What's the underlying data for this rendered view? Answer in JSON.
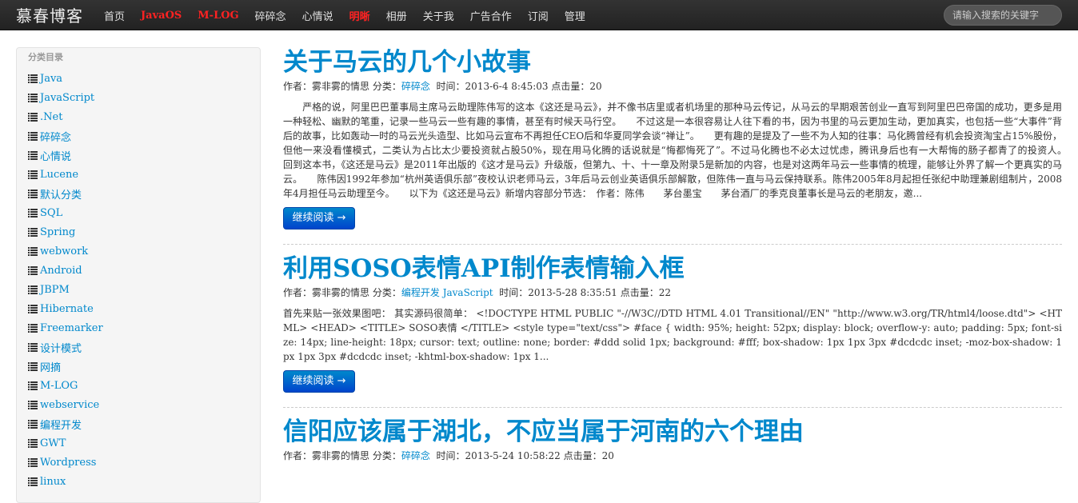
{
  "header": {
    "brand": "慕春博客",
    "nav": [
      {
        "label": "首页",
        "highlight": false
      },
      {
        "label": "JavaOS",
        "highlight": true
      },
      {
        "label": "M-LOG",
        "highlight": true
      },
      {
        "label": "碎碎念",
        "highlight": false
      },
      {
        "label": "心情说",
        "highlight": false
      },
      {
        "label": "明晰",
        "highlight": true
      },
      {
        "label": "相册",
        "highlight": false
      },
      {
        "label": "关于我",
        "highlight": false
      },
      {
        "label": "广告合作",
        "highlight": false
      },
      {
        "label": "订阅",
        "highlight": false
      },
      {
        "label": "管理",
        "highlight": false
      }
    ],
    "search_placeholder": "请输入搜索的关键字"
  },
  "sidebar": {
    "title": "分类目录",
    "categories": [
      "Java",
      "JavaScript",
      ".Net",
      "碎碎念",
      "心情说",
      "Lucene",
      "默认分类",
      "SQL",
      "Spring",
      "webwork",
      "Android",
      "JBPM",
      "Hibernate",
      "Freemarker",
      "设计模式",
      "网摘",
      "M-LOG",
      "webservice",
      "编程开发",
      "GWT",
      "Wordpress",
      "linux"
    ]
  },
  "labels": {
    "author_prefix": "作者：",
    "category_prefix": "分类：",
    "time_prefix": "时间：",
    "clicks_prefix": "点击量：",
    "read_more": "继续阅读 →"
  },
  "posts": [
    {
      "title": "关于马云的几个小故事",
      "author": "雾非雾的情思",
      "categories": "碎碎念",
      "time": "2013-6-4 8:45:03",
      "clicks": "20",
      "excerpt": "　　严格的说，阿里巴巴董事局主席马云助理陈伟写的这本《这还是马云》，并不像书店里或者机场里的那种马云传记，从马云的早期艰苦创业一直写到阿里巴巴帝国的成功，更多是用一种轻松、幽默的笔重，记录一些马云一些有趣的事情，甚至有时候天马行空。　　不过这是一本很容易让人往下看的书，因为书里的马云更加生动，更加真实，也包括一些“大事件”背后的故事，比如轰动一时的马云光头造型、比如马云宣布不再担任CEO后和华夏同学会谈“禅让”。　　更有趣的是提及了一些不为人知的往事：马化腾曾经有机会投资淘宝占15%股份，但他一来没看懂模式，二类认为占比太少要投资就占股50%，现在用马化腾的话说就是“悔都悔死了”。不过马化腾也不必太过忧虑，腾讯身后也有一大帮悔的肠子都青了的投资人。　　回到这本书，《这还是马云》是2011年出版的《这才是马云》升级版，但第九、十、十一章及附录5是新加的内容，也是对这两年马云一些事情的梳理，能够让外界了解一个更真实的马云。　　陈伟因1992年参加“杭州英语俱乐部”夜校认识老师马云，3年后马云创业英语俱乐部解散，但陈伟一直与马云保持联系。陈伟2005年8月起担任张纪中助理兼剧组制片，2008年4月担任马云助理至今。　　以下为《这还是马云》新增内容部分节选：　作者：陈伟　　茅台墨宝　　茅台酒厂的季克良董事长是马云的老朋友，邀..."
    },
    {
      "title": "利用SOSO表情API制作表情输入框",
      "author": "雾非雾的情思",
      "categories": "编程开发 JavaScript",
      "time": "2013-5-28 8:35:51",
      "clicks": "22",
      "excerpt": "首先来贴一张效果图吧： 其实源码很简单： <!DOCTYPE HTML PUBLIC \"-//W3C//DTD HTML 4.01 Transitional//EN\" \"http://www.w3.org/TR/html4/loose.dtd\"> <HTML> <HEAD> <TITLE> SOSO表情 </TITLE> <style type=\"text/css\"> #face { width: 95%; height: 52px; display: block; overflow-y: auto; padding: 5px; font-size: 14px; line-height: 18px; cursor: text; outline: none; border: #ddd solid 1px; background: #fff; box-shadow: 1px 1px 3px #dcdcdc inset; -moz-box-shadow: 1px 1px 3px #dcdcdc inset; -khtml-box-shadow: 1px 1..."
    },
    {
      "title": "信阳应该属于湖北，不应当属于河南的六个理由",
      "author": "雾非雾的情思",
      "categories": "碎碎念",
      "time": "2013-5-24 10:58:22",
      "clicks": "20",
      "excerpt": ""
    }
  ]
}
